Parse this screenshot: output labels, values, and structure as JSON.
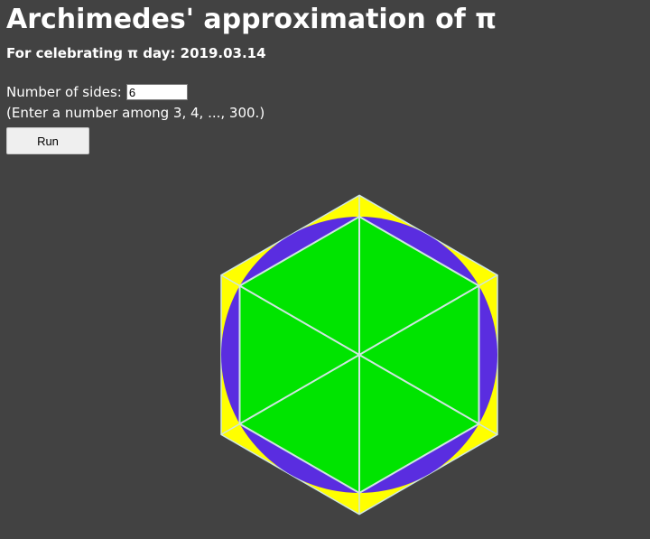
{
  "header": {
    "title": "Archimedes' approximation of π",
    "subtitle": "For celebrating π day: 2019.03.14"
  },
  "controls": {
    "sides_label": "Number of sides:",
    "sides_value": "6",
    "hint": "(Enter a number among 3, 4, ..., 300.)",
    "run_label": "Run"
  },
  "figure": {
    "sides": 6,
    "colors": {
      "background": "#424242",
      "circumscribed_polygon": "#ffff00",
      "circle": "#5a2de0",
      "inscribed_polygon": "#00e400",
      "edge_lines": "#cfe6e0"
    }
  }
}
